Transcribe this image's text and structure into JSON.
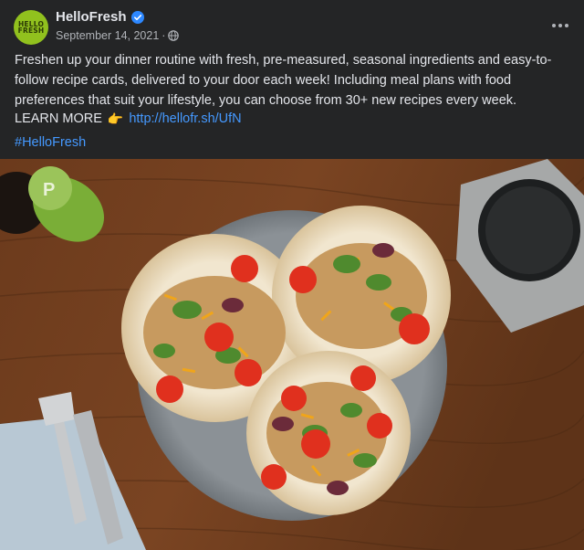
{
  "post": {
    "page_name": "HelloFresh",
    "avatar_text": "HELLO FRESH",
    "date": "September 14, 2021",
    "separator": "·",
    "verified_icon": "verified-badge-icon",
    "privacy_icon": "globe-icon",
    "more_icon": "more-options-icon",
    "body": "Freshen up your dinner routine with fresh, pre-measured, seasonal ingredients and easy-to-follow recipe cards, delivered to your door each week! Including meal plans with food preferences that suit your lifestyle, you can choose from 30+ new recipes every week.",
    "cta_label": "LEARN MORE",
    "cta_link": "http://hellofr.sh/UfN",
    "hashtag": "#HelloFresh",
    "image_alt": "Tacos with greens, tomatoes and cheese on a plate"
  },
  "colors": {
    "background": "#242526",
    "text": "#e4e6eb",
    "secondary_text": "#b0b3b8",
    "link": "#4599ff",
    "brand_green": "#91c11e",
    "verified_blue": "#2d88ff"
  }
}
